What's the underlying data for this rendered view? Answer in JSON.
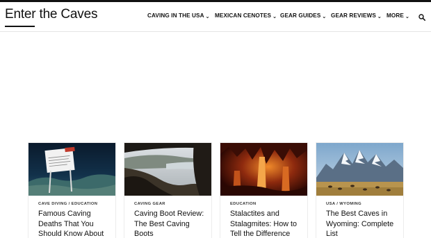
{
  "site": {
    "logo_text": "Enter the Caves"
  },
  "nav": {
    "items": [
      {
        "label": "CAVING IN THE USA",
        "has_dropdown": true
      },
      {
        "label": "MEXICAN CENOTES",
        "has_dropdown": true
      },
      {
        "label": "GEAR GUIDES",
        "has_dropdown": true
      },
      {
        "label": "GEAR REVIEWS",
        "has_dropdown": true
      },
      {
        "label": "MORE",
        "has_dropdown": true
      }
    ],
    "chevron_glyph": "⌄",
    "search_icon": "search-icon"
  },
  "cards": [
    {
      "meta": "CAVE DIVING / EDUCATION",
      "title": "Famous Caving Deaths That You Should Know About",
      "image": "underwater stop sign in cave"
    },
    {
      "meta": "CAVING GEAR",
      "title": "Caving Boot Review: The Best Caving Boots",
      "image": "cave mouth overlooking river valley"
    },
    {
      "meta": "EDUCATION",
      "title": "Stalactites and Stalagmites: How to Tell the Difference",
      "image": "illuminated cave formations"
    },
    {
      "meta": "USA / WYOMING",
      "title": "The Best Caves in Wyoming: Complete List",
      "image": "snowy mountains with bison on plain"
    }
  ],
  "colors": {
    "text": "#111111",
    "border": "#e4e4e4",
    "accent_line": "#111111"
  }
}
